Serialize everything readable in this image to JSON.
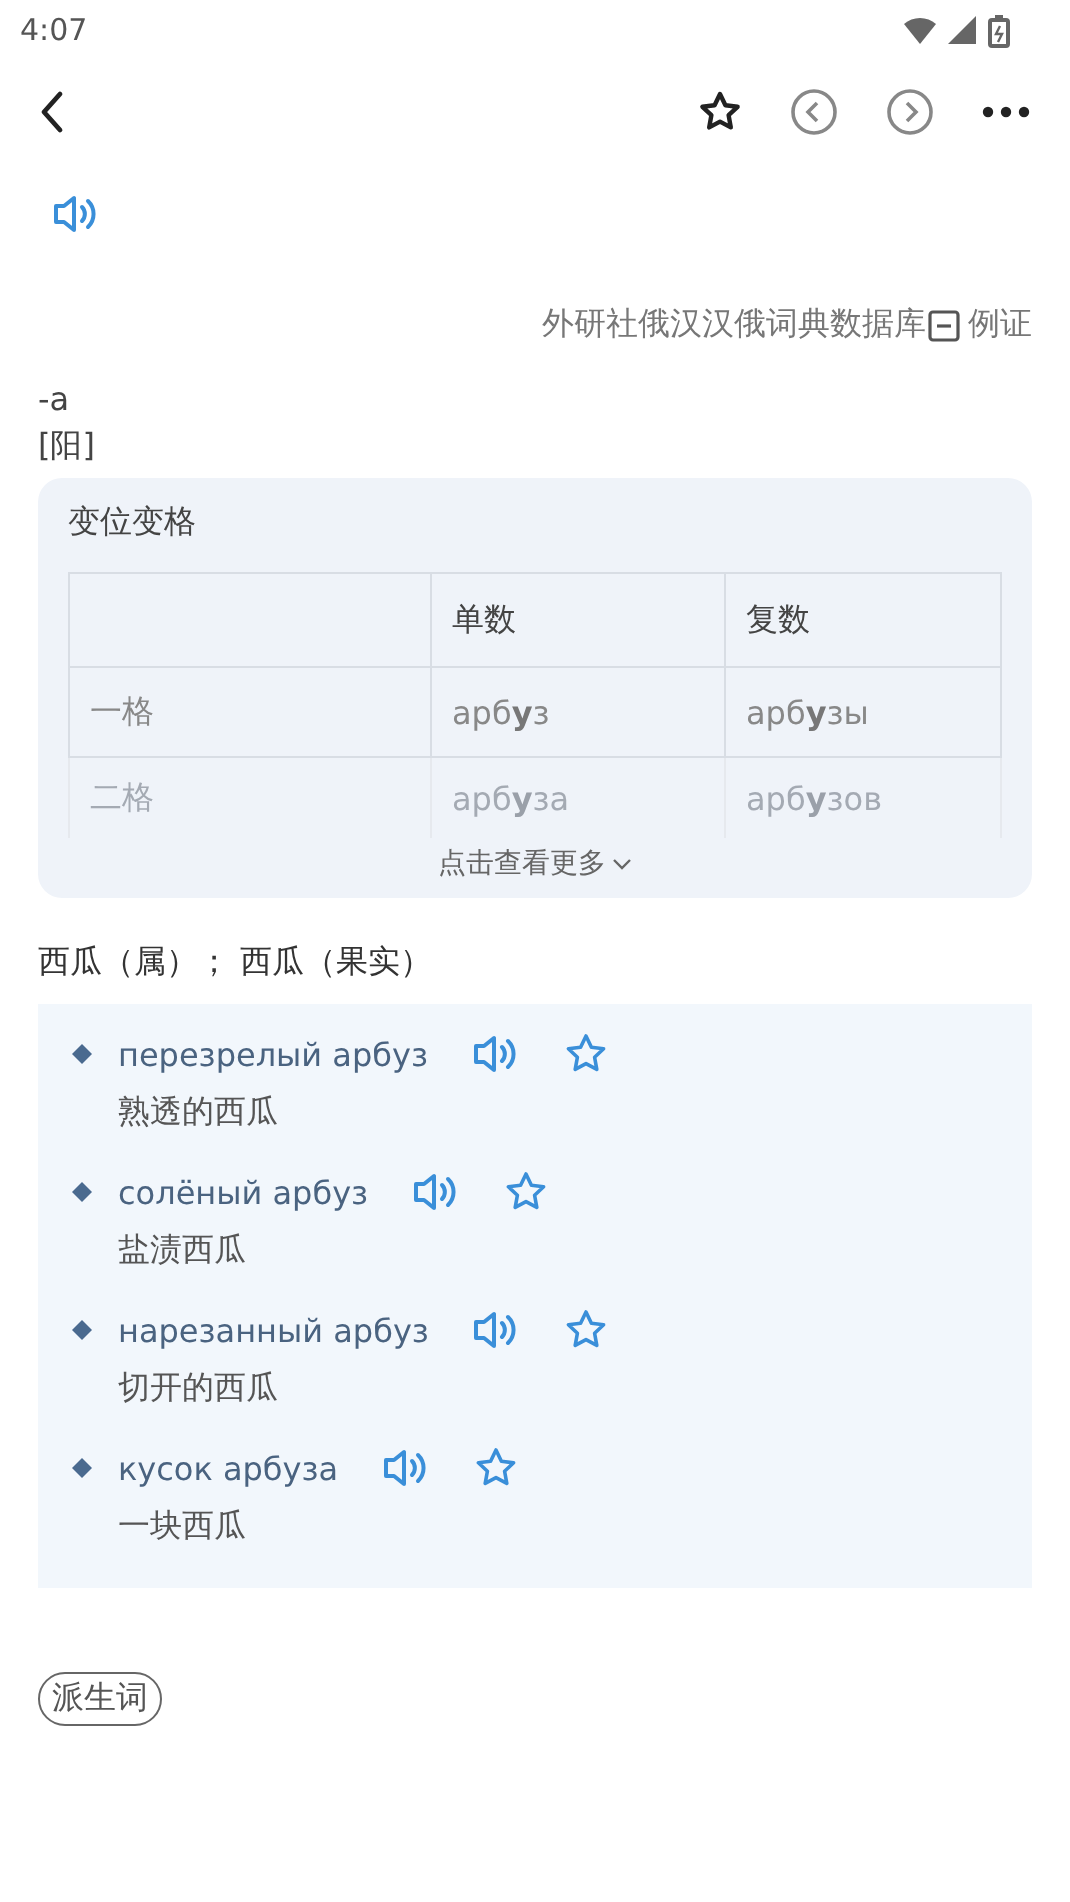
{
  "status_bar": {
    "time": "4:07"
  },
  "source": {
    "text": "外研社俄汉汉俄词典数据库",
    "link": "例证"
  },
  "suffix": "-a",
  "gender": "[阳]",
  "declension": {
    "title": "变位变格",
    "columns": [
      "单数",
      "复数"
    ],
    "rows": [
      {
        "case": "一格",
        "singular": "арб**у**з",
        "plural": "арб**у**зы"
      },
      {
        "case": "二格",
        "singular": "арб**у**за",
        "plural": "арб**у**зов"
      }
    ],
    "more": "点击查看更多"
  },
  "meaning": "西瓜（属）；  西瓜（果实）",
  "examples": [
    {
      "ru": "перезрелый арбуз",
      "zh": "熟透的西瓜"
    },
    {
      "ru": "солёный арбуз",
      "zh": "盐渍西瓜"
    },
    {
      "ru": "нарезанный арбуз",
      "zh": "切开的西瓜"
    },
    {
      "ru": "кусок арбуза",
      "zh": "一块西瓜"
    }
  ],
  "tags": [
    "派生词"
  ]
}
